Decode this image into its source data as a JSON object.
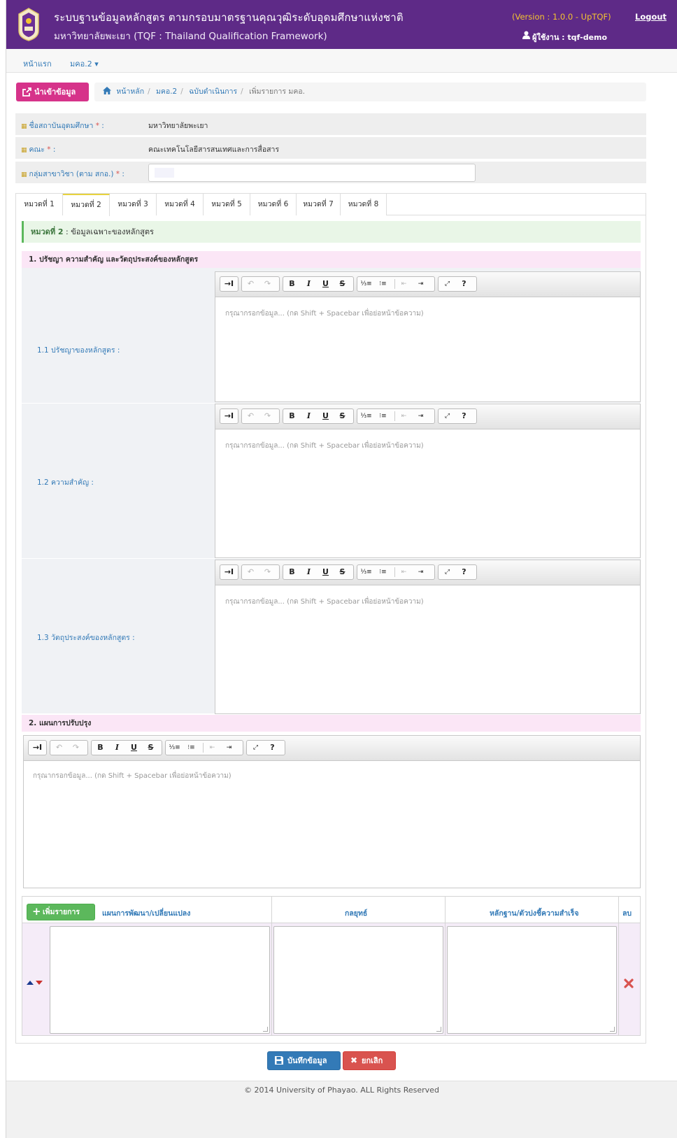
{
  "header": {
    "title_line1": "ระบบฐานข้อมูลหลักสูตร ตามกรอบมาตรฐานคุณวุฒิระดับอุดมศึกษาแห่งชาติ",
    "title_line2": "มหาวิทยาลัยพะเยา (TQF : Thailand Qualification Framework)",
    "version": "(Version : 1.0.0 - UpTQF)",
    "logout": "Logout",
    "user_label": "ผู้ใช้งาน : tqf-demo",
    "colors": {
      "bar": "#5e2a87",
      "version": "#f4c430"
    }
  },
  "nav": {
    "home": "หน้าแรก",
    "menu": "มคอ.2 ▾"
  },
  "actions": {
    "import_button": "นำเข้าข้อมูล"
  },
  "breadcrumb": [
    "หน้าหลัก",
    "มคอ.2",
    "ฉบับดำเนินการ",
    "เพิ่มรายการ มคอ."
  ],
  "info": {
    "institution_label": "ชื่อสถาบันอุดมศึกษา",
    "institution_value": "มหาวิทยาลัยพะเยา",
    "faculty_label": "คณะ",
    "faculty_value": "คณะเทคโนโลยีสารสนเทศและการสื่อสาร",
    "field_group_label": "กลุ่มสาขาวิชา (ตาม สกอ.)",
    "required_mark": "*",
    "colon": ":"
  },
  "tabs": [
    "หมวดที่ 1",
    "หมวดที่ 2",
    "หมวดที่ 3",
    "หมวดที่ 4",
    "หมวดที่ 5",
    "หมวดที่ 6",
    "หมวดที่ 7",
    "หมวดที่ 8"
  ],
  "active_tab_index": 1,
  "section": {
    "title": "หมวดที่ 2",
    "subtitle": " : ข้อมูลเฉพาะของหลักสูตร"
  },
  "part1": {
    "heading": "1. ปรัชญา ความสำคัญ และวัตถุประสงค์ของหลักสูตร",
    "q1": "1.1 ปรัชญาของหลักสูตร :",
    "q2": "1.2 ความสำคัญ :",
    "q3": "1.3 วัตถุประสงค์ของหลักสูตร :"
  },
  "part2": {
    "heading": "2. แผนการปรับปรุง"
  },
  "editor": {
    "placeholder": "กรุณากรอกข้อมูล... (กด Shift + Spacebar เพื่อย่อหน้าข้อความ)",
    "buttons": {
      "indent": "→I",
      "undo": "↶",
      "redo": "↷",
      "bold": "B",
      "italic": "I",
      "underline": "U",
      "strike": "S",
      "ol": "⅓≡",
      "ul": "⁝≡",
      "outdent": "⇤",
      "indent2": "⇥",
      "fullscreen": "⤢",
      "help": "?"
    }
  },
  "plan_table": {
    "add_button": "เพิ่มรายการ",
    "col1": "แผนการพัฒนา/เปลี่ยนแปลง",
    "col2": "กลยุทธ์",
    "col3": "หลักฐาน/ตัวบ่งชี้ความสำเร็จ",
    "col4": "ลบ"
  },
  "bottom": {
    "save": "บันทึกข้อมูล",
    "cancel": "ยกเลิก"
  },
  "footer": "© 2014 University of Phayao. ALL Rights Reserved"
}
